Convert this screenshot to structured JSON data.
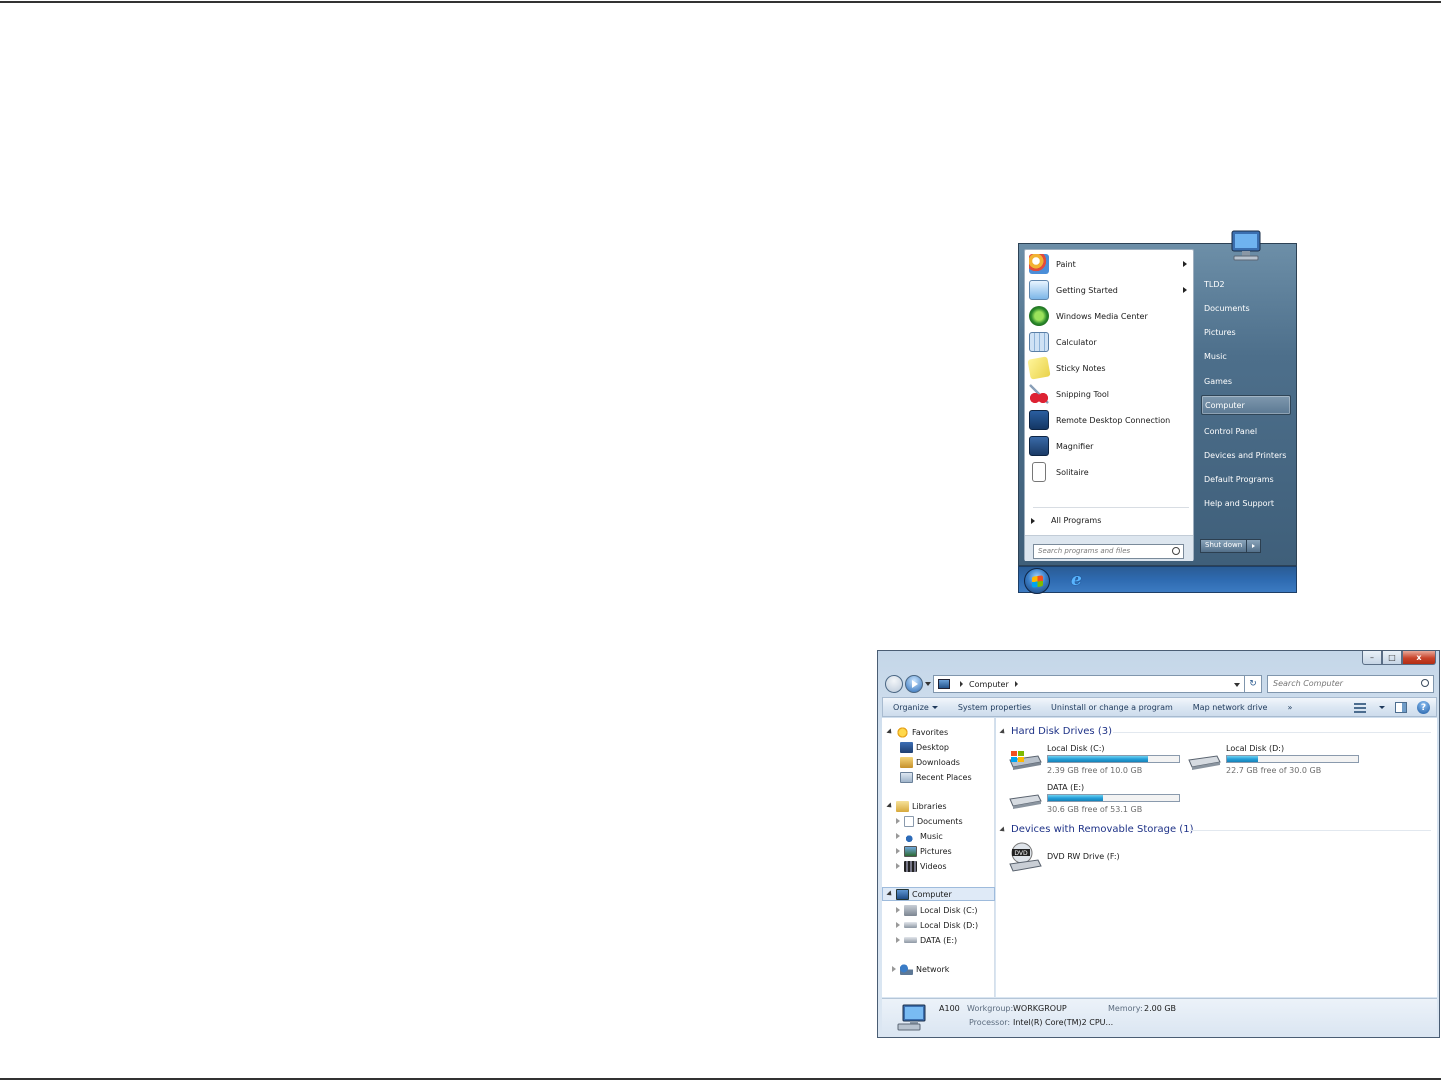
{
  "start_menu": {
    "programs": [
      {
        "label": "Paint",
        "icon": "paint-icon",
        "submenu": true
      },
      {
        "label": "Getting Started",
        "icon": "getting-started-icon",
        "submenu": true
      },
      {
        "label": "Windows Media Center",
        "icon": "media-center-icon",
        "submenu": false
      },
      {
        "label": "Calculator",
        "icon": "calculator-icon",
        "submenu": false
      },
      {
        "label": "Sticky Notes",
        "icon": "sticky-notes-icon",
        "submenu": false
      },
      {
        "label": "Snipping Tool",
        "icon": "snipping-tool-icon",
        "submenu": false
      },
      {
        "label": "Remote Desktop Connection",
        "icon": "remote-desktop-icon",
        "submenu": false
      },
      {
        "label": "Magnifier",
        "icon": "magnifier-icon",
        "submenu": false
      },
      {
        "label": "Solitaire",
        "icon": "solitaire-icon",
        "submenu": false
      }
    ],
    "all_programs": "All Programs",
    "search_placeholder": "Search programs and files",
    "right_items": [
      "TLD2",
      "Documents",
      "Pictures",
      "Music",
      "Games",
      "Computer",
      "Control Panel",
      "Devices and Printers",
      "Default Programs",
      "Help and Support"
    ],
    "highlighted": "Computer",
    "shutdown": "Shut down"
  },
  "explorer": {
    "address": {
      "location": "Computer"
    },
    "search_placeholder": "Search Computer",
    "commands": [
      "Organize",
      "System properties",
      "Uninstall or change a program",
      "Map network drive",
      "»"
    ],
    "nav": {
      "favorites": "Favorites",
      "favorites_items": [
        "Desktop",
        "Downloads",
        "Recent Places"
      ],
      "libraries": "Libraries",
      "libraries_items": [
        "Documents",
        "Music",
        "Pictures",
        "Videos"
      ],
      "computer": "Computer",
      "computer_items": [
        "Local Disk (C:)",
        "Local Disk (D:)",
        "DATA (E:)"
      ],
      "network": "Network"
    },
    "groups": {
      "hdd": "Hard Disk Drives (3)",
      "removable": "Devices with Removable Storage (1)"
    },
    "drives": [
      {
        "name": "Local Disk (C:)",
        "free": "2.39 GB free of 10.0 GB",
        "used_fraction": 0.76
      },
      {
        "name": "Local Disk (D:)",
        "free": "22.7 GB free of 30.0 GB",
        "used_fraction": 0.24
      },
      {
        "name": "DATA (E:)",
        "free": "30.6 GB free of 53.1 GB",
        "used_fraction": 0.42
      }
    ],
    "dvd": {
      "name": "DVD RW Drive (F:)",
      "badge": "DVD"
    },
    "details": {
      "name": "A100",
      "workgroup_label": "Workgroup:",
      "workgroup": "WORKGROUP",
      "memory_label": "Memory:",
      "memory": "2.00 GB",
      "processor_label": "Processor:",
      "processor": "Intel(R) Core(TM)2 CPU..."
    }
  }
}
